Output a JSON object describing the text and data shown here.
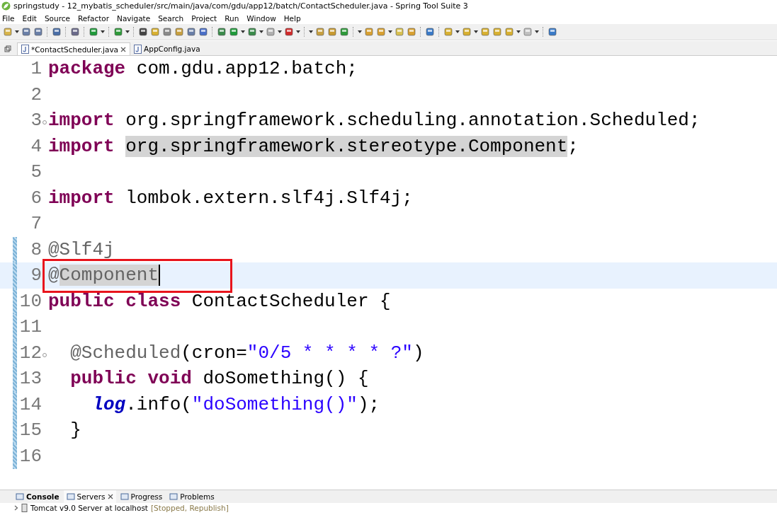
{
  "window": {
    "title": "springstudy - 12_mybatis_scheduler/src/main/java/com/gdu/app12/batch/ContactScheduler.java - Spring Tool Suite 3"
  },
  "menu": [
    "File",
    "Edit",
    "Source",
    "Refactor",
    "Navigate",
    "Search",
    "Project",
    "Run",
    "Window",
    "Help"
  ],
  "editor_tabs": [
    {
      "label": "*ContactScheduler.java",
      "selected": true
    },
    {
      "label": "AppConfig.java",
      "selected": false
    }
  ],
  "code": [
    {
      "number": "1",
      "current": false,
      "changed": false,
      "fold": false,
      "cursor": false,
      "tokens": [
        {
          "kind": "keyword",
          "text": "package"
        },
        {
          "kind": "plain",
          "text": " com.gdu.app12.batch;"
        }
      ]
    },
    {
      "number": "2",
      "current": false,
      "changed": false,
      "fold": false,
      "cursor": false
    },
    {
      "number": "3",
      "current": false,
      "changed": false,
      "fold": true,
      "cursor": false,
      "tokens": [
        {
          "kind": "keyword",
          "text": "import"
        },
        {
          "kind": "plain",
          "text": " org.springframework.scheduling.annotation.Scheduled;"
        }
      ]
    },
    {
      "number": "4",
      "current": false,
      "changed": false,
      "fold": false,
      "cursor": false,
      "tokens": [
        {
          "kind": "keyword",
          "text": "import "
        },
        {
          "kind": "plain",
          "text": "org.springframework.stereotype.Component",
          "marked": true
        },
        {
          "kind": "plain",
          "text": ";",
          "marked": false
        }
      ]
    },
    {
      "number": "5",
      "current": false,
      "changed": false,
      "fold": false,
      "cursor": false
    },
    {
      "number": "6",
      "current": false,
      "changed": false,
      "fold": false,
      "cursor": false,
      "tokens": [
        {
          "kind": "keyword",
          "text": "import"
        },
        {
          "kind": "plain",
          "text": " lombok.extern.slf4j.Slf4j;"
        }
      ]
    },
    {
      "number": "7",
      "current": false,
      "changed": false,
      "fold": false,
      "cursor": false
    },
    {
      "number": "8",
      "current": false,
      "changed": true,
      "fold": false,
      "cursor": false,
      "tokens": [
        {
          "kind": "annotation",
          "text": "@Slf4j"
        }
      ]
    },
    {
      "number": "9",
      "current": true,
      "changed": true,
      "fold": false,
      "cursor": true,
      "tokens": [
        {
          "kind": "annotation",
          "text": "@",
          "marked": false
        },
        {
          "kind": "annotation",
          "text": "Component",
          "marked": true
        }
      ]
    },
    {
      "number": "10",
      "current": false,
      "changed": true,
      "fold": false,
      "cursor": false,
      "tokens": [
        {
          "kind": "keyword",
          "text": "public class"
        },
        {
          "kind": "plain",
          "text": " ContactScheduler {"
        }
      ]
    },
    {
      "number": "11",
      "current": false,
      "changed": true,
      "fold": false,
      "cursor": false
    },
    {
      "number": "12",
      "current": false,
      "changed": true,
      "fold": true,
      "cursor": false,
      "tokens": [
        {
          "kind": "annotation",
          "text": "  @Scheduled"
        },
        {
          "kind": "plain",
          "text": "(cron="
        },
        {
          "kind": "string",
          "text": "\"0/5 * * * * ?\""
        },
        {
          "kind": "plain",
          "text": ")"
        }
      ]
    },
    {
      "number": "13",
      "current": false,
      "changed": true,
      "fold": false,
      "cursor": false,
      "tokens": [
        {
          "kind": "keyword",
          "text": "  public void"
        },
        {
          "kind": "plain",
          "text": " doSomething() {"
        }
      ]
    },
    {
      "number": "14",
      "current": false,
      "changed": true,
      "fold": false,
      "cursor": false,
      "tokens": [
        {
          "kind": "field",
          "text": "    log"
        },
        {
          "kind": "plain",
          "text": ".info("
        },
        {
          "kind": "string",
          "text": "\"doSomething()\""
        },
        {
          "kind": "plain",
          "text": ");"
        }
      ]
    },
    {
      "number": "15",
      "current": false,
      "changed": true,
      "fold": false,
      "cursor": false,
      "tokens": [
        {
          "kind": "plain",
          "text": "  }"
        }
      ]
    },
    {
      "number": "16",
      "current": false,
      "changed": true,
      "fold": false,
      "cursor": false
    }
  ],
  "bottom_tabs": [
    {
      "label": "Console",
      "selected": false,
      "bold": true
    },
    {
      "label": "Servers",
      "selected": true,
      "bold": false
    },
    {
      "label": "Progress",
      "selected": false,
      "bold": false
    },
    {
      "label": "Problems",
      "selected": false,
      "bold": false
    }
  ],
  "servers": [
    {
      "name": "Tomcat v9.0 Server at localhost",
      "status": "[Stopped, Republish]"
    }
  ]
}
